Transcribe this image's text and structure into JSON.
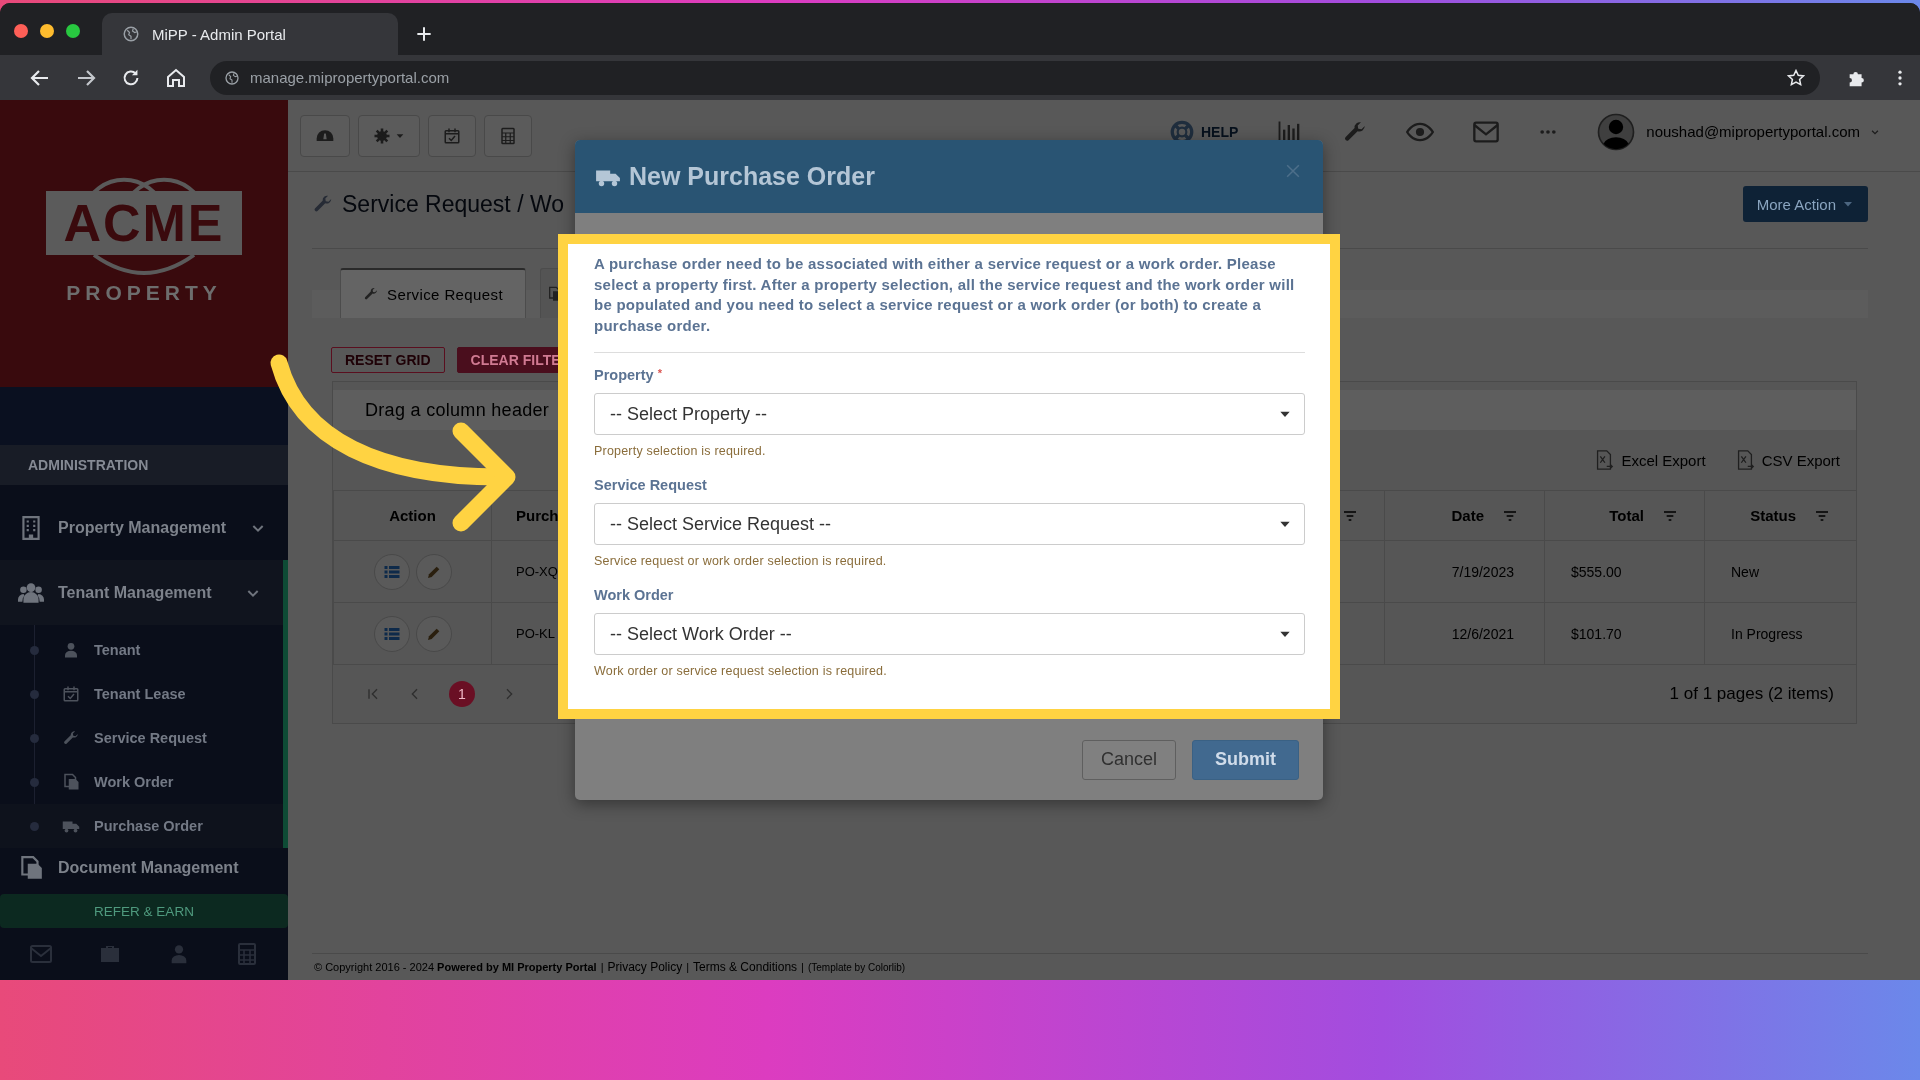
{
  "browser": {
    "tab_title": "MiPP - Admin Portal",
    "url": "manage.mipropertyportal.com"
  },
  "sidebar": {
    "logo": {
      "wordmark": "ACME",
      "tagline": "PROPERTY"
    },
    "section_title": "ADMINISTRATION",
    "items": [
      {
        "label": "Property Management",
        "expanded": false
      },
      {
        "label": "Tenant Management",
        "expanded": true,
        "children": [
          {
            "label": "Tenant",
            "selected": false
          },
          {
            "label": "Tenant Lease",
            "selected": false
          },
          {
            "label": "Service Request",
            "selected": false
          },
          {
            "label": "Work Order",
            "selected": false
          },
          {
            "label": "Purchase Order",
            "selected": true
          }
        ]
      },
      {
        "label": "Document Management",
        "expanded": false
      }
    ],
    "refer_button": "REFER & EARN"
  },
  "header": {
    "help": "HELP",
    "user": "noushad@mipropertyportal.com"
  },
  "page": {
    "title": "Service Request / Wo",
    "more_action": "More Action",
    "tabs": [
      {
        "label": "Service Request",
        "selected": true
      },
      {
        "selected": false
      }
    ],
    "buttons": [
      {
        "label": "RESET GRID",
        "kind": "outline"
      },
      {
        "label": "CLEAR FILTE",
        "kind": "filled"
      }
    ],
    "grid": {
      "group_hint": "Drag a column header",
      "exports": [
        "Excel Export",
        "CSV Export"
      ],
      "columns": [
        {
          "label": "Action",
          "filterable": false
        },
        {
          "label": "Purch"
        },
        {
          "filterable": true
        },
        {
          "label": "Date",
          "filterable": true
        },
        {
          "label": "Total",
          "filterable": true
        },
        {
          "label": "Status",
          "filterable": true
        }
      ],
      "rows": [
        {
          "column_2": "PO-XQ",
          "date": "7/19/2023",
          "total": "$555.00",
          "status": "New"
        },
        {
          "column_2": "PO-KL",
          "date": "12/6/2021",
          "total": "$101.70",
          "status": "In Progress"
        }
      ],
      "pager": {
        "pages": [
          {
            "label": "1",
            "selected": true
          }
        ],
        "info": "1 of 1 pages (2 items)"
      }
    }
  },
  "footer": [
    {
      "kind": "text",
      "text": "© Copyright 2016 - 2024 **Powered by MI Property Portal**"
    },
    {
      "kind": "separator",
      "text": "|"
    },
    {
      "kind": "link",
      "text": "Privacy Policy"
    },
    {
      "kind": "separator",
      "text": "|"
    },
    {
      "kind": "link",
      "text": "Terms & Conditions"
    },
    {
      "kind": "separator",
      "text": "|"
    },
    {
      "kind": "credit",
      "text": "(Template by Colorlib)"
    }
  ],
  "modal": {
    "title": "New Purchase Order",
    "description": "A purchase order need to be associated with either a service request or a work order. Please select a property first. After a property selection, all the service request and the work order will be populated and you need to select a service request or a work order (or both) to create a purchase order.",
    "fields": [
      {
        "label": "Property",
        "required_mark": "*",
        "value": "-- Select Property --",
        "help": "Property selection is required."
      },
      {
        "label": "Service Request",
        "value": "-- Select Service Request --",
        "help": "Service request or work order selection is required."
      },
      {
        "label": "Work Order",
        "value": "-- Select Work Order --",
        "help": "Work order or service request selection is required."
      }
    ],
    "buttons": [
      {
        "label": "Cancel",
        "kind": "default"
      },
      {
        "label": "Submit",
        "kind": "primary"
      }
    ]
  }
}
